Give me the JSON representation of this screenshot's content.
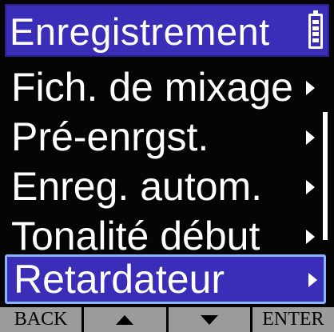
{
  "header": {
    "title": "Enregistrement",
    "battery_icon": "battery-full-icon"
  },
  "menu": {
    "items": [
      {
        "label": "Fich. de mixage",
        "has_submenu": true,
        "selected": false
      },
      {
        "label": "Pré-enrgst.",
        "has_submenu": true,
        "selected": false
      },
      {
        "label": "Enreg. autom.",
        "has_submenu": true,
        "selected": false
      },
      {
        "label": "Tonalité début",
        "has_submenu": true,
        "selected": false
      },
      {
        "label": "Retardateur",
        "has_submenu": true,
        "selected": true
      }
    ]
  },
  "softkeys": {
    "back": "BACK",
    "up_icon": "up-arrow-icon",
    "down_icon": "down-arrow-icon",
    "enter": "ENTER"
  },
  "colors": {
    "accent": "#3a2db8",
    "selection_border": "#8ab4ff",
    "softkey_bg": "#9b9b9b",
    "background": "#050505",
    "text": "#ffffff"
  }
}
